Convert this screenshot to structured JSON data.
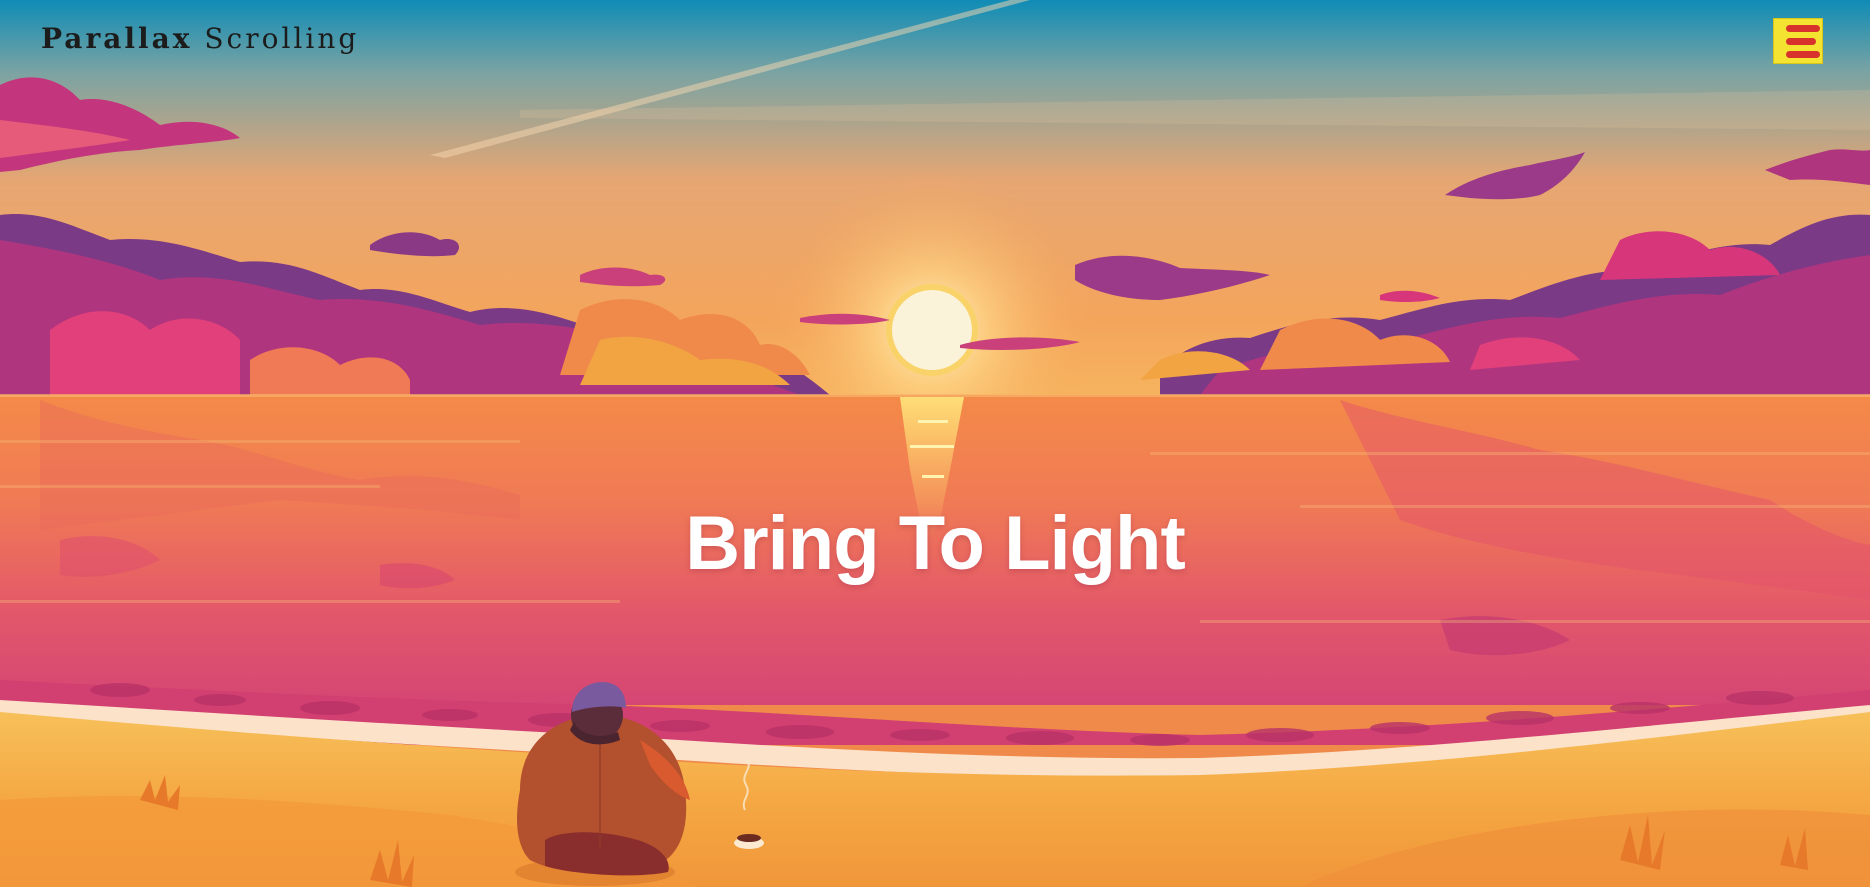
{
  "header": {
    "logo_strong": "Parallax",
    "logo_light": "Scrolling",
    "menu_icon": "hamburger-menu-icon"
  },
  "hero": {
    "title": "Bring To Light"
  },
  "scene": {
    "description_layers": [
      "sky",
      "sun",
      "clouds",
      "sea",
      "sun-reflection",
      "shore-foam",
      "beach",
      "sitting-person",
      "coffee-cup"
    ]
  },
  "colors": {
    "sky_top": "#1a8fb4",
    "sky_mid": "#e9a870",
    "sky_horizon": "#f2a55a",
    "cloud_purple": "#8a3a85",
    "cloud_pink": "#d7367a",
    "cloud_orange": "#f0884a",
    "sea_top": "#f28a4a",
    "sea_bottom": "#d94a72",
    "sand": "#f5b042",
    "sun": "#fbf2d6",
    "menu_bg": "#f4e330",
    "menu_bars": "#d8322c",
    "title": "#ffffff"
  }
}
